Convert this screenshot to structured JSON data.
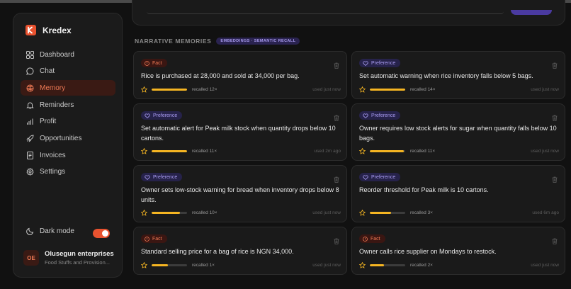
{
  "brand": {
    "name": "Kredex",
    "accent": "#e8522f"
  },
  "nav": [
    {
      "label": "Dashboard",
      "icon": "grid-icon"
    },
    {
      "label": "Chat",
      "icon": "chat-icon"
    },
    {
      "label": "Memory",
      "icon": "brain-icon",
      "active": true
    },
    {
      "label": "Reminders",
      "icon": "bell-icon"
    },
    {
      "label": "Profit",
      "icon": "bar-chart-icon"
    },
    {
      "label": "Opportunities",
      "icon": "rocket-icon"
    },
    {
      "label": "Invoices",
      "icon": "document-icon"
    },
    {
      "label": "Settings",
      "icon": "gear-icon"
    }
  ],
  "dark_mode": {
    "label": "Dark mode",
    "enabled": true
  },
  "user": {
    "initials": "OE",
    "name": "Olusegun enterprises",
    "subtitle": "Food Stuffs and Provision..."
  },
  "section": {
    "title": "NARRATIVE MEMORIES",
    "tag": "EMBEDDINGS · SEMANTIC RECALL"
  },
  "cards": [
    {
      "type": "Fact",
      "text": "Rice is purchased at 28,000 and sold at 34,000 per bag.",
      "recalled": "recalled 12×",
      "strength": 1.0,
      "used": "used just now"
    },
    {
      "type": "Preference",
      "text": "Set automatic warning when rice inventory falls below 5 bags.",
      "recalled": "recalled 14×",
      "strength": 1.0,
      "used": "used just now"
    },
    {
      "type": "Preference",
      "text": "Set automatic alert for Peak milk stock when quantity drops below 10 cartons.",
      "recalled": "recalled 11×",
      "strength": 1.0,
      "used": "used 2m ago"
    },
    {
      "type": "Preference",
      "text": "Owner requires low stock alerts for sugar when quantity falls below 10 bags.",
      "recalled": "recalled 11×",
      "strength": 0.96,
      "used": "used just now"
    },
    {
      "type": "Preference",
      "text": "Owner sets low-stock warning for bread when inventory drops below 8 units.",
      "recalled": "recalled 10×",
      "strength": 0.8,
      "used": "used just now"
    },
    {
      "type": "Preference",
      "text": "Reorder threshold for Peak milk is 10 cartons.",
      "recalled": "recalled 3×",
      "strength": 0.6,
      "used": "used 6m ago"
    },
    {
      "type": "Fact",
      "text": "Standard selling price for a bag of rice is NGN 34,000.",
      "recalled": "recalled 1×",
      "strength": 0.45,
      "used": "used just now"
    },
    {
      "type": "Fact",
      "text": "Owner calls rice supplier on Mondays to restock.",
      "recalled": "recalled 2×",
      "strength": 0.4,
      "used": "used just now"
    }
  ]
}
